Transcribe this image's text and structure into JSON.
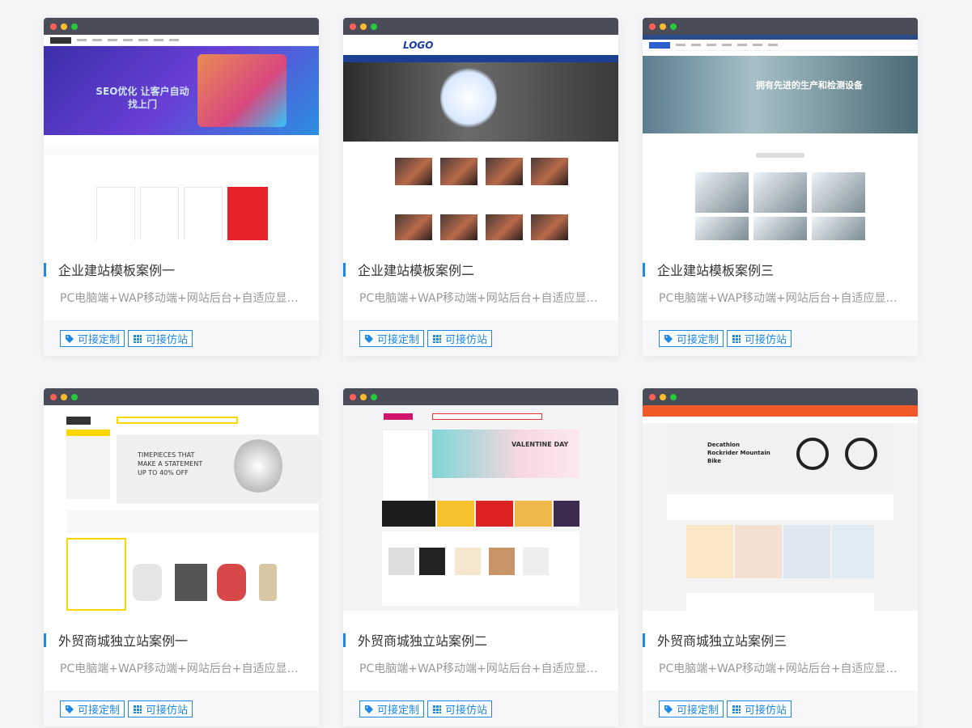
{
  "cards": [
    {
      "title": "企业建站模板案例一",
      "desc": "PC电脑端+WAP移动端+网站后台+自适应显示...",
      "tag1": "可接定制",
      "tag2": "可接仿站",
      "preview_text": "SEO优化 让客户自动找上门"
    },
    {
      "title": "企业建站模板案例二",
      "desc": "PC电脑端+WAP移动端+网站后台+自适应显示...",
      "tag1": "可接定制",
      "tag2": "可接仿站",
      "preview_text": "LOGO"
    },
    {
      "title": "企业建站模板案例三",
      "desc": "PC电脑端+WAP移动端+网站后台+自适应显示...",
      "tag1": "可接定制",
      "tag2": "可接仿站",
      "preview_text": "拥有先进的生产和检测设备"
    },
    {
      "title": "外贸商城独立站案例一",
      "desc": "PC电脑端+WAP移动端+网站后台+自适应显示...",
      "tag1": "可接定制",
      "tag2": "可接仿站",
      "preview_text": "TIMEPIECES THAT MAKE A STATEMENT UP TO 40% OFF"
    },
    {
      "title": "外贸商城独立站案例二",
      "desc": "PC电脑端+WAP移动端+网站后台+自适应显示...",
      "tag1": "可接定制",
      "tag2": "可接仿站",
      "preview_text": "VALENTINE DAY"
    },
    {
      "title": "外贸商城独立站案例三",
      "desc": "PC电脑端+WAP移动端+网站后台+自适应显示...",
      "tag1": "可接定制",
      "tag2": "可接仿站",
      "preview_text": "Decathlon Rockrider Mountain Bike"
    }
  ],
  "icons": {
    "tag1": "tag-icon",
    "tag2": "grid-icon",
    "accent": "#1e88e5"
  }
}
